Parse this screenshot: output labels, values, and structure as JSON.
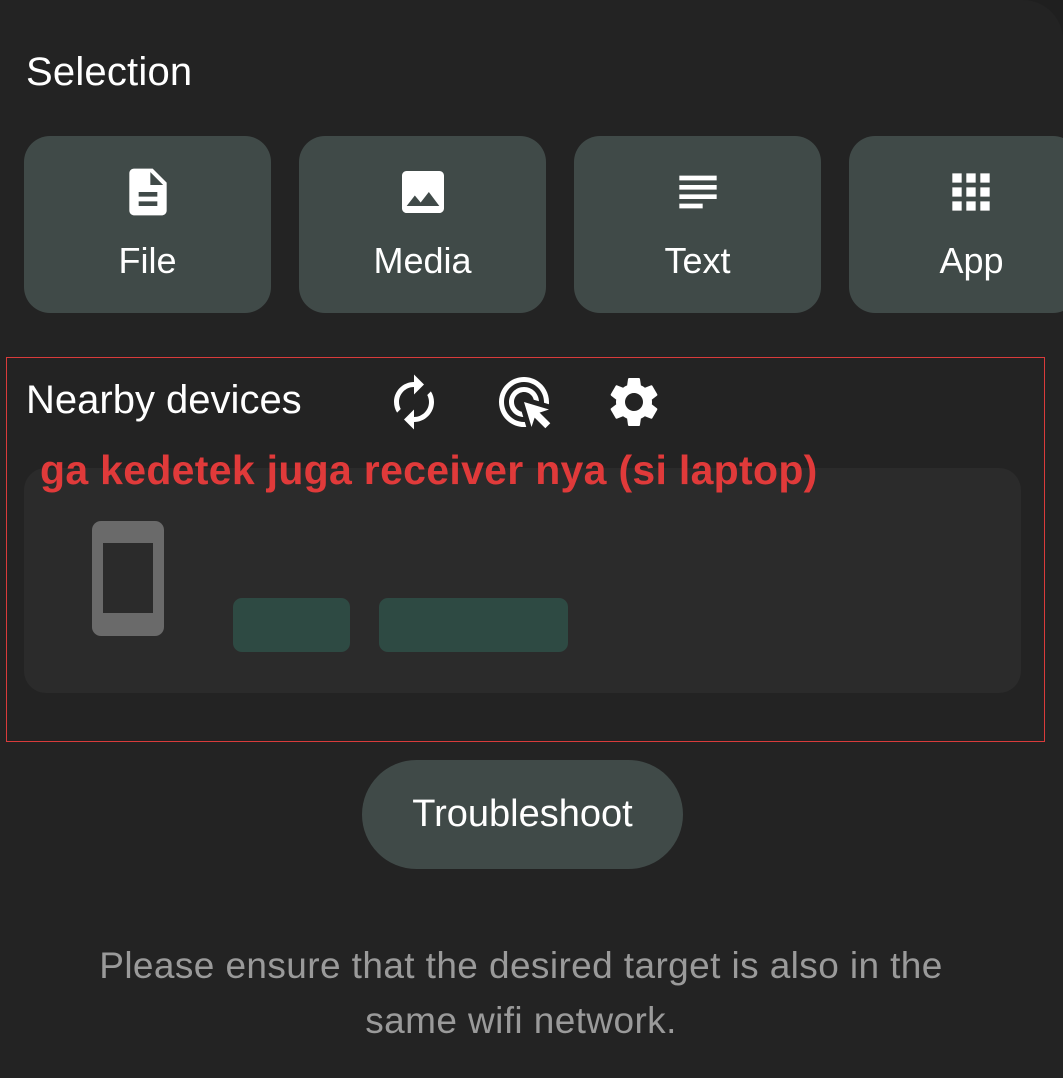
{
  "selection": {
    "title": "Selection",
    "buttons": [
      {
        "label": "File",
        "icon": "file-icon"
      },
      {
        "label": "Media",
        "icon": "image-icon"
      },
      {
        "label": "Text",
        "icon": "text-lines-icon"
      },
      {
        "label": "App",
        "icon": "app-grid-icon"
      }
    ]
  },
  "nearby": {
    "title": "Nearby devices",
    "icons": [
      "refresh-icon",
      "cursor-target-icon",
      "gear-icon"
    ],
    "annotation": "ga kedetek juga receiver nya (si laptop)",
    "annotation_color": "#e03a3a"
  },
  "troubleshoot": {
    "label": "Troubleshoot"
  },
  "hint": {
    "text": "Please ensure that the desired target is also in the same wifi network."
  },
  "colors": {
    "background": "#232323",
    "button": "#404a48",
    "card": "#2b2b2b",
    "skeleton": "#2e4a43",
    "frame": "#d93b3b"
  }
}
